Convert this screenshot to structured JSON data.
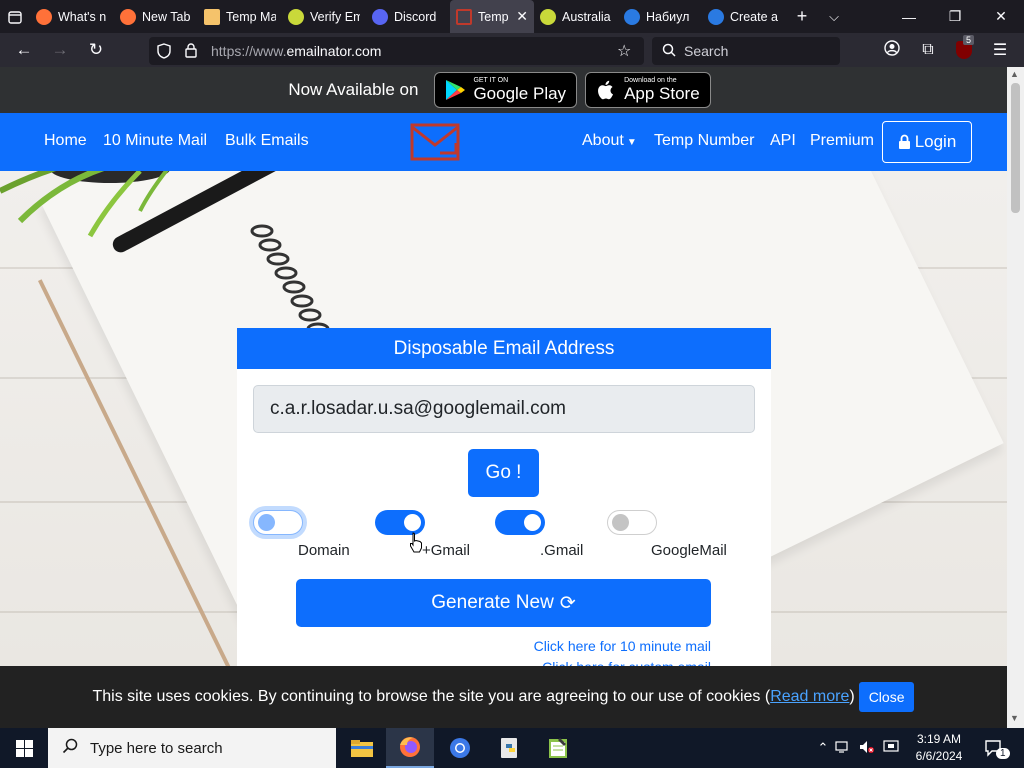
{
  "browser": {
    "tabs": [
      {
        "label": "What's n",
        "color": "#ff7139"
      },
      {
        "label": "New Tab",
        "color": "#ff7139"
      },
      {
        "label": "Temp Ma",
        "color": "#f5c36b"
      },
      {
        "label": "Verify Em",
        "color": "#c9d93a"
      },
      {
        "label": "Discord",
        "color": "#5865f2"
      },
      {
        "label": "Temp",
        "color": "#c0392b",
        "active": true
      },
      {
        "label": "Australia",
        "color": "#c9d93a"
      },
      {
        "label": "Набиул",
        "color": "#2a7ae2"
      },
      {
        "label": "Create a",
        "color": "#2a7ae2"
      }
    ],
    "url_dim": "https://www.",
    "url_host": "emailnator.com",
    "search_placeholder": "Search",
    "ublock_count": "5"
  },
  "promo": {
    "text": "Now Available on",
    "google_small": "GET IT ON",
    "google_big": "Google Play",
    "apple_small": "Download on the",
    "apple_big": "App Store"
  },
  "site_nav": {
    "home": "Home",
    "ten_minute": "10 Minute Mail",
    "bulk": "Bulk Emails",
    "about": "About",
    "temp_number": "Temp Number",
    "api": "API",
    "premium": "Premium",
    "login": "Login"
  },
  "card": {
    "title": "Disposable Email Address",
    "email": "c.a.r.losadar.u.sa@googlemail.com",
    "go": "Go !",
    "options": [
      {
        "label": "Domain",
        "state": "focus"
      },
      {
        "label": "+Gmail",
        "state": "on"
      },
      {
        "label": ".Gmail",
        "state": "on"
      },
      {
        "label": "GoogleMail",
        "state": "off"
      }
    ],
    "generate": "Generate New",
    "link_ten_minute": "Click here for 10 minute mail",
    "link_custom": "Click here for custom email"
  },
  "cookie": {
    "text": "This site uses cookies. By continuing to browse the site you are agreeing to our use of cookies (",
    "link": "Read more",
    "tail": ")",
    "close": "Close"
  },
  "taskbar": {
    "search_placeholder": "Type here to search",
    "time": "3:19 AM",
    "date": "6/6/2024",
    "notification_count": "1"
  },
  "colors": {
    "primary": "#0d6efd",
    "browser_dark": "#1c1b22",
    "cookie_bg": "#222222"
  }
}
